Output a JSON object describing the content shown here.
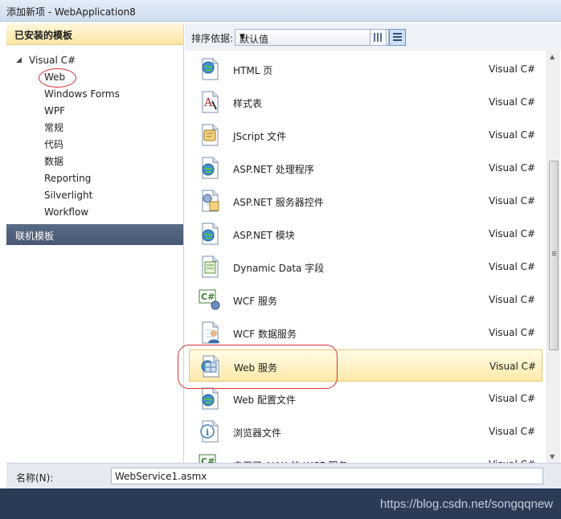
{
  "window": {
    "title": "添加新项 - WebApplication8"
  },
  "left_panel": {
    "installed_header": "已安装的模板",
    "tree": {
      "root": "Visual C#",
      "children": [
        "Web",
        "Windows Forms",
        "WPF",
        "常规",
        "代码",
        "数据",
        "Reporting",
        "Silverlight",
        "Workflow"
      ]
    },
    "online_header": "联机模板"
  },
  "sortbar": {
    "label": "排序依据:",
    "selected": "默认值"
  },
  "items": [
    {
      "name": "HTML 页",
      "lang": "Visual C#",
      "icon": "html-page-icon"
    },
    {
      "name": "样式表",
      "lang": "Visual C#",
      "icon": "stylesheet-icon"
    },
    {
      "name": "JScript 文件",
      "lang": "Visual C#",
      "icon": "jscript-file-icon"
    },
    {
      "name": "ASP.NET 处理程序",
      "lang": "Visual C#",
      "icon": "aspnet-handler-icon"
    },
    {
      "name": "ASP.NET 服务器控件",
      "lang": "Visual C#",
      "icon": "server-control-icon"
    },
    {
      "name": "ASP.NET 模块",
      "lang": "Visual C#",
      "icon": "aspnet-module-icon"
    },
    {
      "name": "Dynamic Data 字段",
      "lang": "Visual C#",
      "icon": "dynamic-data-icon"
    },
    {
      "name": "WCF 服务",
      "lang": "Visual C#",
      "icon": "wcf-service-icon"
    },
    {
      "name": "WCF 数据服务",
      "lang": "Visual C#",
      "icon": "wcf-data-service-icon"
    },
    {
      "name": "Web 服务",
      "lang": "Visual C#",
      "icon": "web-service-icon"
    },
    {
      "name": "Web 配置文件",
      "lang": "Visual C#",
      "icon": "web-config-icon"
    },
    {
      "name": "浏览器文件",
      "lang": "Visual C#",
      "icon": "browser-file-icon"
    },
    {
      "name": "启用了 AJAX 的 WCF 服务",
      "lang": "Visual C#",
      "icon": "ajax-wcf-icon"
    }
  ],
  "selected_item": "Web 服务",
  "namebar": {
    "label": "名称(N):",
    "value": "WebService1.asmx"
  },
  "watermark": "https://blog.csdn.net/songqqnew",
  "colors": {
    "selection": "#fde9a9",
    "highlight_circle": "#d9343b",
    "footer": "#2b3a55"
  }
}
